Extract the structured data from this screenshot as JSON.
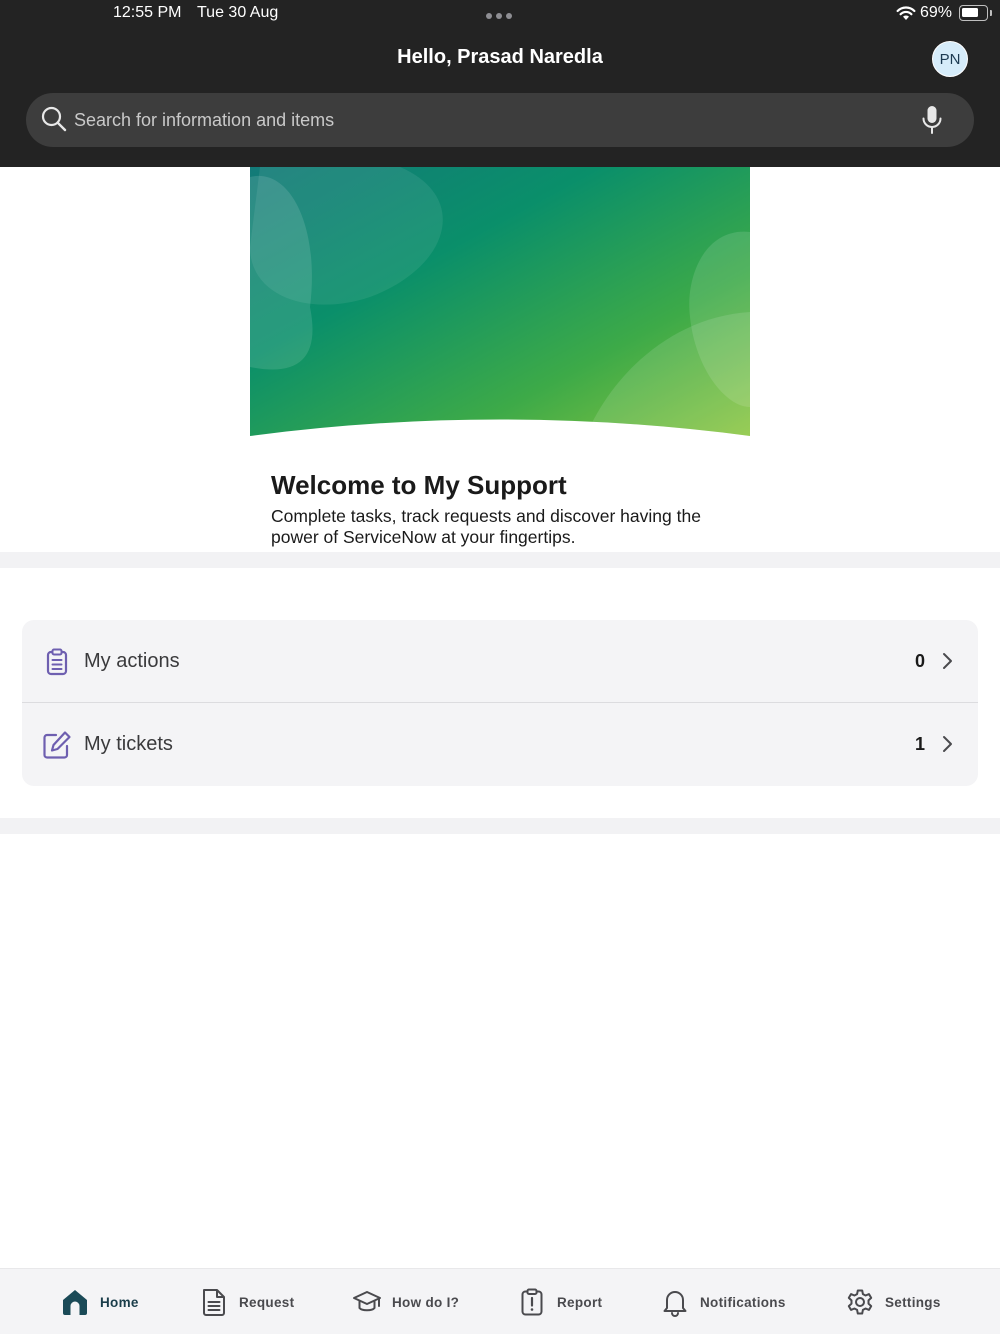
{
  "status_bar": {
    "time": "12:55 PM",
    "date": "Tue 30 Aug",
    "battery_percent": "69%",
    "battery_level": 0.69
  },
  "header": {
    "greeting": "Hello, Prasad Naredla",
    "avatar_initials": "PN"
  },
  "search": {
    "placeholder": "Search for information and items",
    "icon": "search-icon",
    "voice_icon": "microphone-icon"
  },
  "welcome": {
    "title": "Welcome to My Support",
    "description": "Complete tasks, track requests and discover having the power of ServiceNow at your fingertips."
  },
  "list": {
    "items": [
      {
        "label": "My actions",
        "count": "0",
        "icon": "clipboard-icon"
      },
      {
        "label": "My tickets",
        "count": "1",
        "icon": "edit-icon"
      }
    ]
  },
  "tabbar": {
    "items": [
      {
        "label": "Home",
        "icon": "home-icon",
        "active": true
      },
      {
        "label": "Request",
        "icon": "document-icon",
        "active": false
      },
      {
        "label": "How do I?",
        "icon": "graduation-cap-icon",
        "active": false
      },
      {
        "label": "Report",
        "icon": "report-clipboard-icon",
        "active": false
      },
      {
        "label": "Notifications",
        "icon": "bell-icon",
        "active": false
      },
      {
        "label": "Settings",
        "icon": "gear-icon",
        "active": false
      }
    ]
  },
  "colors": {
    "header_bg": "#232323",
    "accent_purple": "#6e5fb0",
    "tab_active": "#1a4a57",
    "banner_start": "#11807a",
    "banner_end": "#8cc63f"
  }
}
